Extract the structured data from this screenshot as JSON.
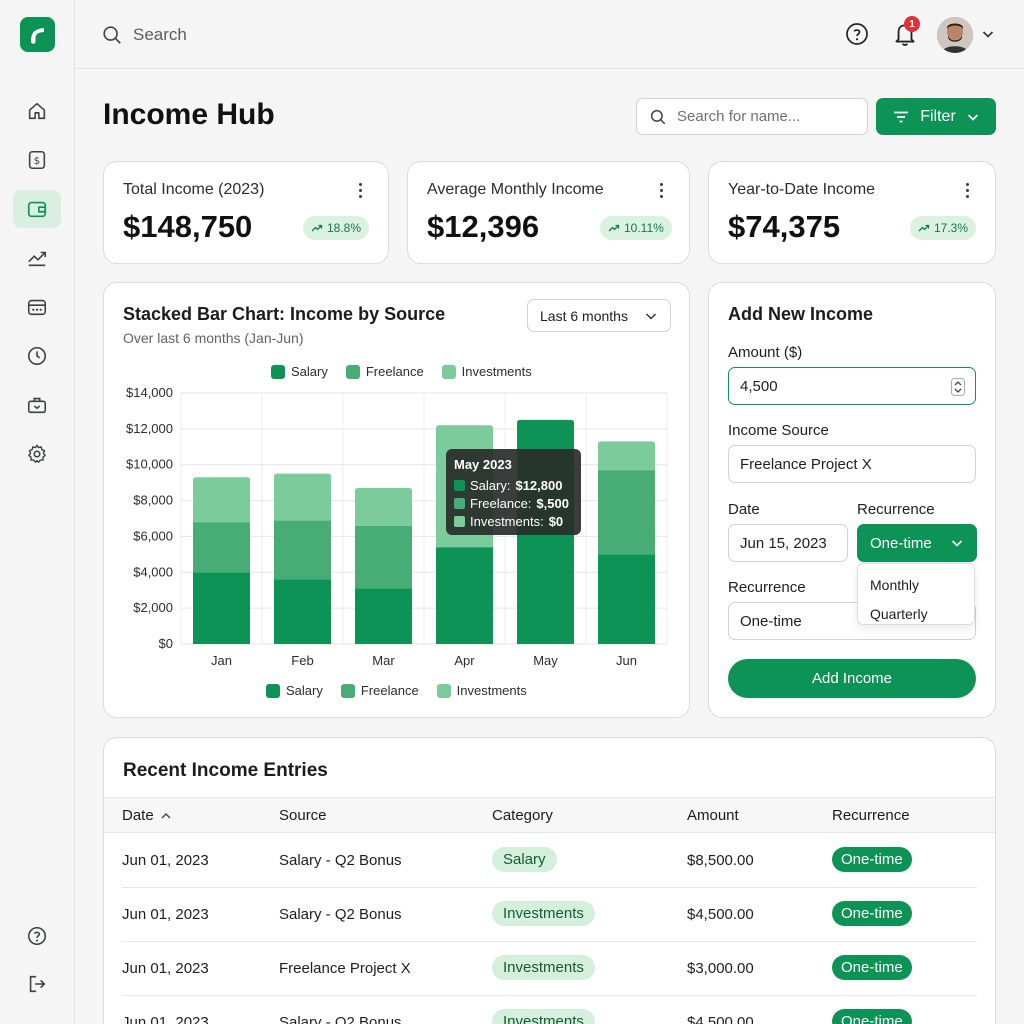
{
  "topbar": {
    "search_label": "Search",
    "notification_count": "1"
  },
  "page": {
    "title": "Income Hub",
    "search_placeholder": "Search for name...",
    "filter_label": "Filter"
  },
  "stats": [
    {
      "title": "Total Income (2023)",
      "value": "$148,750",
      "trend": "18.8%"
    },
    {
      "title": "Average Monthly Income",
      "value": "$12,396",
      "trend": "10.11%"
    },
    {
      "title": "Year-to-Date Income",
      "value": "$74,375",
      "trend": "17.3%"
    }
  ],
  "chart_card": {
    "title": "Stacked Bar Chart: Income by Source",
    "subtitle": "Over last 6 months (Jan-Jun)",
    "period": "Last 6 months"
  },
  "chart_data": {
    "type": "bar",
    "stacked": true,
    "categories": [
      "Jan",
      "Feb",
      "Mar",
      "Apr",
      "May",
      "Jun"
    ],
    "series": [
      {
        "name": "Salary",
        "values": [
          4000,
          3600,
          3100,
          5400,
          12500,
          5000
        ]
      },
      {
        "name": "Freelance",
        "values": [
          2800,
          3300,
          3500,
          0,
          0,
          4700
        ]
      },
      {
        "name": "Investments",
        "values": [
          2500,
          2600,
          2100,
          6800,
          0,
          1600
        ]
      }
    ],
    "y_ticks": [
      "$14,000",
      "$12,000",
      "$10,000",
      "$8,000",
      "$6,000",
      "$4,000",
      "$2,000",
      "$0"
    ],
    "ylim": [
      0,
      14000
    ],
    "colors": [
      "#0d9355",
      "#48ad74",
      "#7ccb9a"
    ],
    "grid": true,
    "legend_position": "top and bottom"
  },
  "tooltip": {
    "title": "May 2023",
    "rows": [
      {
        "label": "Salary:",
        "value": "$12,800"
      },
      {
        "label": "Freelance:",
        "value": "$,500"
      },
      {
        "label": "Investments:",
        "value": "$0"
      }
    ]
  },
  "form": {
    "title": "Add New Income",
    "amount_label": "Amount ($)",
    "amount_value": "4,500",
    "source_label": "Income Source",
    "source_value": "Freelance Project X",
    "date_label": "Date",
    "date_value": "Jun 15, 2023",
    "recurrence_label": "Recurrence",
    "recurrence_value": "One-time",
    "dropdown_options": [
      "Monthly",
      "Quarterly"
    ],
    "recurrence2_label": "Recurrence",
    "recurrence2_value": "One-time",
    "submit_label": "Add Income"
  },
  "table": {
    "title": "Recent Income Entries",
    "columns": [
      "Date",
      "Source",
      "Category",
      "Amount",
      "Recurrence"
    ],
    "rows": [
      {
        "date": "Jun 01, 2023",
        "source": "Salary - Q2 Bonus",
        "category": "Salary",
        "amount": "$8,500.00",
        "recurrence": "One-time"
      },
      {
        "date": "Jun 01, 2023",
        "source": "Salary - Q2 Bonus",
        "category": "Investments",
        "amount": "$4,500.00",
        "recurrence": "One-time"
      },
      {
        "date": "Jun 01, 2023",
        "source": "Freelance Project X",
        "category": "Investments",
        "amount": "$3,000.00",
        "recurrence": "One-time"
      },
      {
        "date": "Jun 01, 2023",
        "source": "Salary - Q2 Bonus",
        "category": "Investments",
        "amount": "$4,500.00",
        "recurrence": "One-time"
      }
    ]
  },
  "icons": {
    "logo": "app-logo",
    "nav": [
      "home-icon",
      "dollar-icon",
      "wallet-icon",
      "trend-icon",
      "calendar-icon",
      "clock-icon",
      "briefcase-icon",
      "gear-icon"
    ],
    "bottom": [
      "help-icon",
      "logout-icon"
    ]
  },
  "colors": {
    "accent": "#0d9355",
    "accent_light": "#dbeee2",
    "badge_red": "#e0303a"
  }
}
